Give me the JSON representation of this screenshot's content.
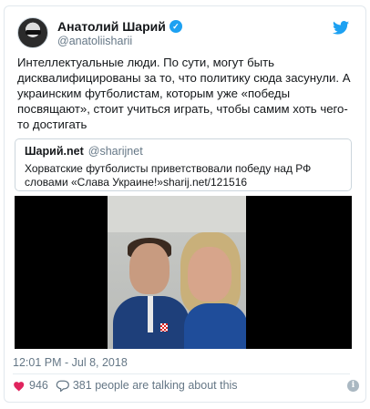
{
  "tweet": {
    "display_name": "Анатолий Шарий",
    "handle": "@anatoliisharii",
    "verified": true,
    "text": "Интеллектуальные люди. По сути, могут быть дисквалифицированы за то, что политику сюда засунули. А украинским футболистам, которым уже «победы посвящают», стоит учиться играть, чтобы самим хоть чего-то достигать",
    "timestamp": "12:01 PM - Jul 8, 2018",
    "likes": "946",
    "replies_label": "381 people are talking about this"
  },
  "quoted_tweet": {
    "display_name": "Шарий.net",
    "handle": "@sharijnet",
    "text": "Хорватские футболисты приветствовали победу над РФ словами «Слава Украине!»sharij.net/121516"
  },
  "colors": {
    "accent": "#1da1f2",
    "like_red": "#e0245e",
    "muted": "#657786"
  },
  "icons": {
    "brand": "twitter-bird-icon",
    "verified": "verified-badge-icon",
    "like": "heart-icon",
    "reply": "comment-icon",
    "info": "info-icon"
  }
}
